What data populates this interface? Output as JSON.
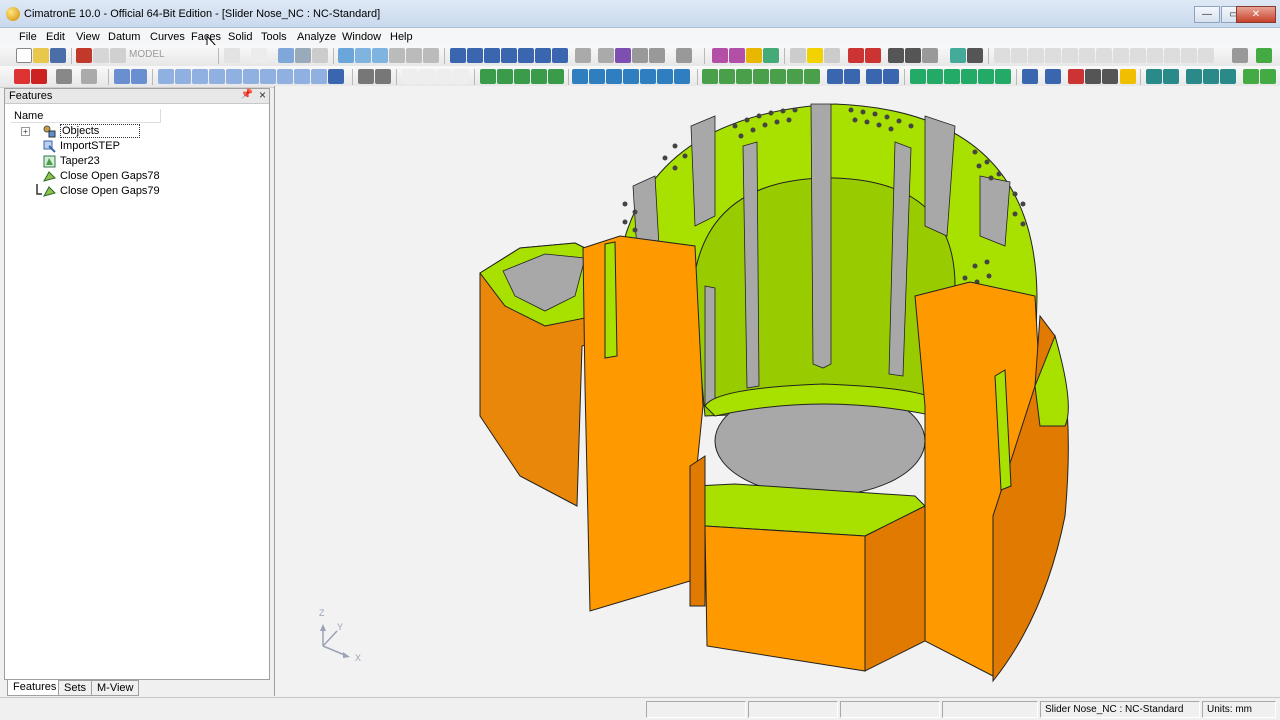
{
  "window": {
    "title": "CimatronE 10.0 - Official 64-Bit Edition - [Slider Nose_NC : NC-Standard]",
    "min_glyph": "—",
    "max_glyph": "▭",
    "close_glyph": "✕",
    "mdi_controls": "– ▫ ×"
  },
  "menu": [
    {
      "label": "File"
    },
    {
      "label": "Edit"
    },
    {
      "label": "View"
    },
    {
      "label": "Datum"
    },
    {
      "label": "Curves"
    },
    {
      "label": "Faces"
    },
    {
      "label": "Solid"
    },
    {
      "label": "Tools"
    },
    {
      "label": "Analyze"
    },
    {
      "label": "Window"
    },
    {
      "label": "Help"
    }
  ],
  "toolbar": {
    "mode_label": "MODEL"
  },
  "features_panel": {
    "title": "Features",
    "pin_glyph": "📌",
    "close_glyph": "×",
    "column_name": "Name",
    "items": [
      {
        "label": "Objects",
        "icon": "objects-icon",
        "expander": "+"
      },
      {
        "label": "ImportSTEP",
        "icon": "import-step-icon"
      },
      {
        "label": "Taper23",
        "icon": "taper-icon"
      },
      {
        "label": "Close Open Gaps78",
        "icon": "close-gaps-icon"
      },
      {
        "label": "Close Open Gaps79",
        "icon": "close-gaps-icon"
      }
    ],
    "tabs": [
      {
        "label": "Features"
      },
      {
        "label": "Sets"
      },
      {
        "label": "M-View"
      }
    ]
  },
  "viewport": {
    "axis_labels": {
      "z": "Z",
      "y": "Y",
      "x": "X"
    },
    "colors": {
      "background": "#f2f2f2",
      "orange": "#ff9900",
      "orange_shade": "#e07a00",
      "green": "#a8e000",
      "gray": "#a8a8a8"
    }
  },
  "status": {
    "document": "Slider Nose_NC : NC-Standard",
    "units": "Units: mm"
  }
}
